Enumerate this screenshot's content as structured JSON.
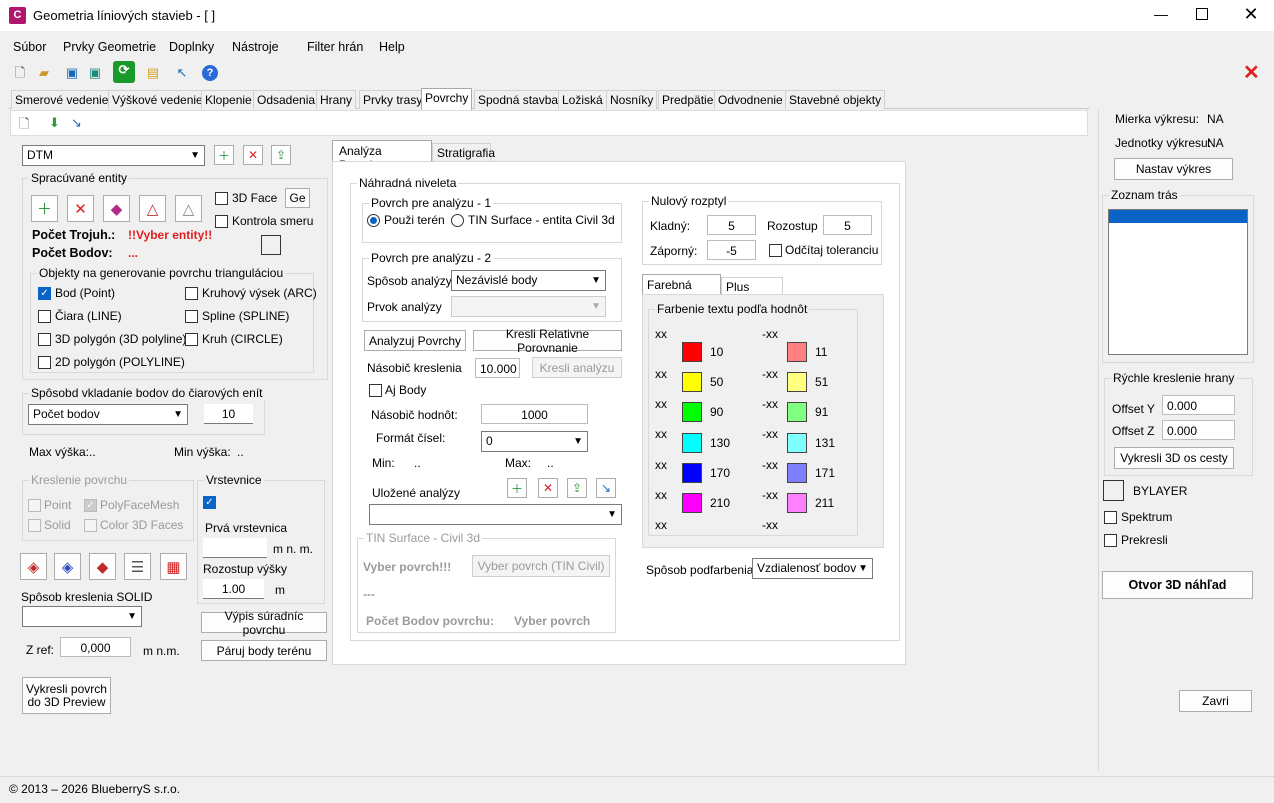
{
  "window": {
    "title": "Geometria líniových stavieb - [ ]",
    "app_badge": "C",
    "footer": "© 2013 – 2026 BlueberryS s.r.o."
  },
  "menu": [
    "Súbor",
    "Prvky Geometrie",
    "Doplnky",
    "Nástroje",
    "Filter hrán",
    "Help"
  ],
  "tabs": [
    "Smerové vedenie",
    "Výškové vedenie",
    "Klopenie",
    "Odsadenia",
    "Hrany",
    "Prvky trasy",
    "Povrchy",
    "Spodná stavba",
    "Ložiská",
    "Nosníky",
    "Predpätie",
    "Odvodnenie",
    "Stavebné objekty"
  ],
  "active_tab": "Povrchy",
  "left": {
    "surface_select": "DTM",
    "entities_group": "Spracúvané entity",
    "face3d": "3D Face",
    "ge_btn": "Ge",
    "kontrola": "Kontrola smeru",
    "pocet_troj_label": "Počet Trojuh.:",
    "pocet_troj_value": "!!Vyber entity!!",
    "pocet_bodov_label": "Počet Bodov:",
    "pocet_bodov_value": "...",
    "objekty_group": "Objekty na generovanie povrchu trianguláciou",
    "objects": [
      "Bod (Point)",
      "Čiara (LINE)",
      "3D polygón (3D polyline)",
      "2D polygón (POLYLINE)",
      "Kruhový výsek (ARC)",
      "Spline (SPLINE)",
      "Kruh (CIRCLE)"
    ],
    "sposob_group": "Spôsobd vkladanie bodov do čiarových enít",
    "sposob_select": "Počet bodov",
    "sposob_value": "10",
    "max_vyska": "Max výška:",
    "max_vyska_val": "..",
    "min_vyska": "Min výška:",
    "min_vyska_val": "..",
    "kreslenie_group": "Kreslenie povrchu",
    "kr_point": "Point",
    "kr_polyface": "PolyFaceMesh",
    "kr_solid": "Solid",
    "kr_color3d": "Color 3D Faces",
    "vrstevnice_group": "Vrstevnice",
    "farebne": "Farbené zobrazenie",
    "prva_vrstevnica": "Prvá vrstevnica",
    "mnm": "m n. m.",
    "rozstup_vysky": "Rozostup výšky",
    "rozstup_value": "1.00",
    "m": "m",
    "sposob_solid": "Spôsob kreslenia SOLID",
    "vypis_btn": "Výpis súradníc povrchu",
    "zref_label": "Z ref:",
    "zref_value": "0,000",
    "zref_unit": "m n.m.",
    "paruj_btn": "Páruj body terénu",
    "vykresli_btn": "Vykresli povrch do 3D Preview"
  },
  "center": {
    "tabs": [
      "Analýza Povrchov",
      "Stratigrafia"
    ],
    "nahradna": "Náhradná niveleta",
    "povrch1": "Povrch pre analýzu - 1",
    "radio_teren": "Použi terén",
    "radio_tin": "TIN Surface - entita Civil 3d",
    "povrch2": "Povrch pre analýzu - 2",
    "sposob_analyzy": "Spôsob analýzy",
    "sposob_analyzy_val": "Nezávislé body",
    "prvok_analyzy": "Prvok analýzy",
    "analyzuj_btn": "Analyzuj Povrchy",
    "relativne_btn": "Kresli Relativne Porovnanie",
    "nasobic_kreslenia": "Násobič kreslenia",
    "nasobic_kreslenia_val": "10.000",
    "kresli_analyzu": "Kresli analýzu",
    "aj_body": "Aj Body",
    "nasobic_hodnot": "Násobič hodnôt:",
    "nasobic_hodnot_val": "1000",
    "format_cisel": "Formát čísel:",
    "format_val": "0",
    "min": "Min:",
    "min_val": "..",
    "max": "Max:",
    "max_val": "..",
    "ulozene": "Uložené analýzy",
    "tin_group": "TIN Surface - Civil 3d",
    "vyber_povrch_lbl": "Vyber povrch!!!",
    "vyber_povrch_btn": "Vyber povrch (TIN Civil)",
    "dots": "---",
    "pocet_bodov_povrchu": "Počet Bodov povrchu:",
    "pocet_bodov_povrchu_val": "Vyber povrch",
    "nulovy": "Nulový rozptyl",
    "kladny": "Kladný:",
    "kladny_val": "5",
    "rozstup": "Rozostup",
    "rozstup_val": "5",
    "zaporny": "Záporný:",
    "zaporny_val": "-5",
    "odcitaj": "Odčítaj toleranciu",
    "scale_tabs": [
      "Farebná škála",
      "Plus Mínus"
    ],
    "farbenie": "Farbenie textu podľa hodnôt",
    "xx": "xx",
    "mxx": "-xx",
    "pos_values": [
      "10",
      "50",
      "90",
      "130",
      "170",
      "210"
    ],
    "pos_colors": [
      "#ff0000",
      "#ffff00",
      "#00ff00",
      "#00ffff",
      "#0000ff",
      "#ff00ff"
    ],
    "neg_values": [
      "11",
      "51",
      "91",
      "131",
      "171",
      "211"
    ],
    "neg_colors": [
      "#ff8080",
      "#ffff80",
      "#80ff80",
      "#80ffff",
      "#8080ff",
      "#ff80ff"
    ],
    "podfarbenie": "Spôsob podfarbenia",
    "podfarbenie_val": "Vzdialenosť bodov"
  },
  "right": {
    "mierka": "Mierka výkresu:",
    "mierka_val": "NA",
    "jednotky": "Jednotky výkresu:",
    "jednotky_val": "NA",
    "nastav": "Nastav výkres",
    "zoznam": "Zoznam trás",
    "rychle": "Rýchle kreslenie hrany",
    "offset_y": "Offset Y",
    "offset_y_val": "0.000",
    "offset_z": "Offset Z",
    "offset_z_val": "0.000",
    "vykresli3d": "Vykresli 3D os cesty",
    "bylayer": "BYLAYER",
    "spektrum": "Spektrum",
    "prekresli": "Prekresli",
    "otvor": "Otvor 3D náhľad",
    "zavri": "Zavri"
  }
}
